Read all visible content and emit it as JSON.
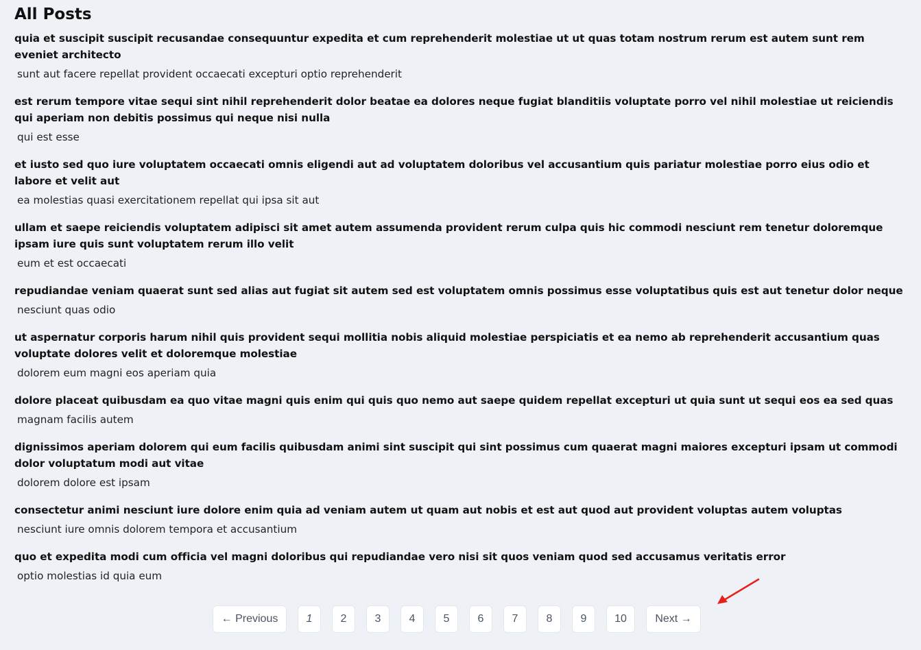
{
  "page": {
    "title": "All Posts"
  },
  "posts": [
    {
      "title": "quia et suscipit suscipit recusandae consequuntur expedita et cum reprehenderit molestiae ut ut quas totam nostrum rerum est autem sunt rem eveniet architecto",
      "body": "sunt aut facere repellat provident occaecati excepturi optio reprehenderit"
    },
    {
      "title": "est rerum tempore vitae sequi sint nihil reprehenderit dolor beatae ea dolores neque fugiat blanditiis voluptate porro vel nihil molestiae ut reiciendis qui aperiam non debitis possimus qui neque nisi nulla",
      "body": "qui est esse"
    },
    {
      "title": "et iusto sed quo iure voluptatem occaecati omnis eligendi aut ad voluptatem doloribus vel accusantium quis pariatur molestiae porro eius odio et labore et velit aut",
      "body": "ea molestias quasi exercitationem repellat qui ipsa sit aut"
    },
    {
      "title": "ullam et saepe reiciendis voluptatem adipisci sit amet autem assumenda provident rerum culpa quis hic commodi nesciunt rem tenetur doloremque ipsam iure quis sunt voluptatem rerum illo velit",
      "body": "eum et est occaecati"
    },
    {
      "title": "repudiandae veniam quaerat sunt sed alias aut fugiat sit autem sed est voluptatem omnis possimus esse voluptatibus quis est aut tenetur dolor neque",
      "body": "nesciunt quas odio"
    },
    {
      "title": "ut aspernatur corporis harum nihil quis provident sequi mollitia nobis aliquid molestiae perspiciatis et ea nemo ab reprehenderit accusantium quas voluptate dolores velit et doloremque molestiae",
      "body": "dolorem eum magni eos aperiam quia"
    },
    {
      "title": "dolore placeat quibusdam ea quo vitae magni quis enim qui quis quo nemo aut saepe quidem repellat excepturi ut quia sunt ut sequi eos ea sed quas",
      "body": "magnam facilis autem"
    },
    {
      "title": "dignissimos aperiam dolorem qui eum facilis quibusdam animi sint suscipit qui sint possimus cum quaerat magni maiores excepturi ipsam ut commodi dolor voluptatum modi aut vitae",
      "body": "dolorem dolore est ipsam"
    },
    {
      "title": "consectetur animi nesciunt iure dolore enim quia ad veniam autem ut quam aut nobis et est aut quod aut provident voluptas autem voluptas",
      "body": "nesciunt iure omnis dolorem tempora et accusantium"
    },
    {
      "title": "quo et expedita modi cum officia vel magni doloribus qui repudiandae vero nisi sit quos veniam quod sed accusamus veritatis error",
      "body": "optio molestias id quia eum"
    }
  ],
  "pagination": {
    "previous_label": "← Previous",
    "next_label": "Next →",
    "pages": [
      "1",
      "2",
      "3",
      "4",
      "5",
      "6",
      "7",
      "8",
      "9",
      "10"
    ],
    "current_page": "1"
  },
  "annotation": {
    "arrow_color": "#e8201c",
    "arrow_target": "Next →"
  }
}
